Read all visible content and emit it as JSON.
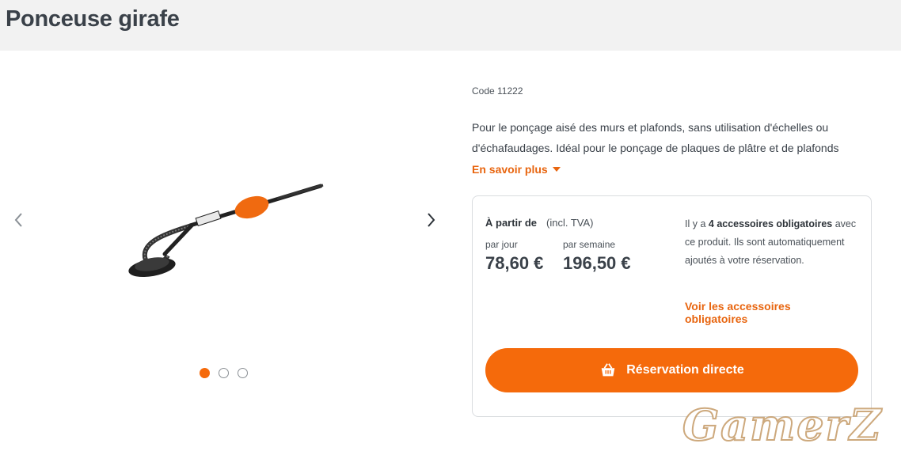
{
  "page": {
    "title": "Ponceuse girafe"
  },
  "product": {
    "code": "Code 11222",
    "description": "Pour le ponçage aisé des murs et plafonds, sans utilisation d'échelles ou d'échafaudages. Idéal pour le ponçage de plaques de plâtre et de plafonds",
    "more_label": "En savoir plus",
    "image_icon": "drywall-sander-image"
  },
  "carousel": {
    "prev_icon": "chevron-left-icon",
    "next_icon": "chevron-right-icon",
    "dots": 3,
    "active_dot": 1
  },
  "pricing": {
    "from_label": "À partir de",
    "vat_label": "(incl. TVA)",
    "per_day_label": "par jour",
    "per_day_price": "78,60 €",
    "per_week_label": "par semaine",
    "per_week_price": "196,50 €"
  },
  "accessories": {
    "text_prefix": "Il y a",
    "count_label": "4 accessoires obligatoires",
    "text_suffix": "avec ce produit. Ils sont automatiquement ajoutés à votre réservation.",
    "link_label": "Voir les accessoires obligatoires"
  },
  "reserve_button": {
    "label": "Réservation directe",
    "icon": "basket-icon"
  },
  "watermark": {
    "text": "GamerZ"
  },
  "colors": {
    "accent": "#f56a0b",
    "link": "#e8650f",
    "header_bg": "#f2f2f2",
    "text": "#3a4149"
  }
}
